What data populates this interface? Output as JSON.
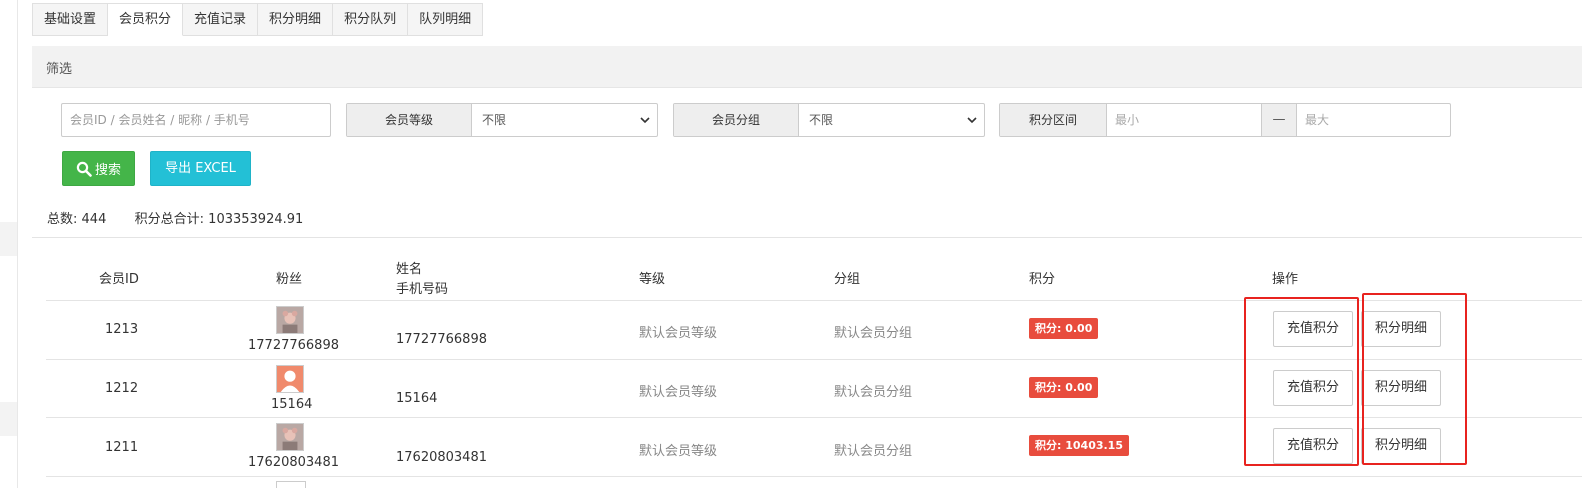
{
  "tabs": [
    "基础设置",
    "会员积分",
    "充值记录",
    "积分明细",
    "积分队列",
    "队列明细"
  ],
  "active_tab": 1,
  "filter_title": "筛选",
  "search": {
    "placeholder": "会员ID / 会员姓名 / 昵称 / 手机号"
  },
  "level_filter": {
    "label": "会员等级",
    "value": "不限"
  },
  "group_filter": {
    "label": "会员分组",
    "value": "不限"
  },
  "points_range": {
    "label": "积分区间",
    "min_placeholder": "最小",
    "separator": "—",
    "max_placeholder": "最大"
  },
  "buttons": {
    "search": "搜索",
    "export": "导出 EXCEL"
  },
  "summary": {
    "total_label": "总数:",
    "total": "444",
    "points_label": "积分总合计:",
    "points_total": "103353924.91"
  },
  "columns": {
    "id": "会员ID",
    "fans": "粉丝",
    "name": "姓名",
    "phone": "手机号码",
    "level": "等级",
    "group": "分组",
    "points": "积分",
    "actions": "操作"
  },
  "rows": [
    {
      "id": "1213",
      "fan_name": "17727766898",
      "avatar": "photo-avatar",
      "phone": "17727766898",
      "level": "默认会员等级",
      "group": "默认会员分组",
      "points": "积分: 0.00",
      "recharge": "充值积分",
      "detail": "积分明细"
    },
    {
      "id": "1212",
      "fan_name": "15164",
      "avatar": "default-avatar",
      "phone": "15164",
      "level": "默认会员等级",
      "group": "默认会员分组",
      "points": "积分: 0.00",
      "recharge": "充值积分",
      "detail": "积分明细"
    },
    {
      "id": "1211",
      "fan_name": "17620803481",
      "avatar": "photo-avatar",
      "phone": "17620803481",
      "level": "默认会员等级",
      "group": "默认会员分组",
      "points": "积分: 10403.15",
      "recharge": "充值积分",
      "detail": "积分明细"
    }
  ],
  "colors": {
    "search_btn": "#44b549",
    "export_btn": "#23c0d6",
    "badge": "#e84c3d",
    "highlight": "#e8231f"
  }
}
